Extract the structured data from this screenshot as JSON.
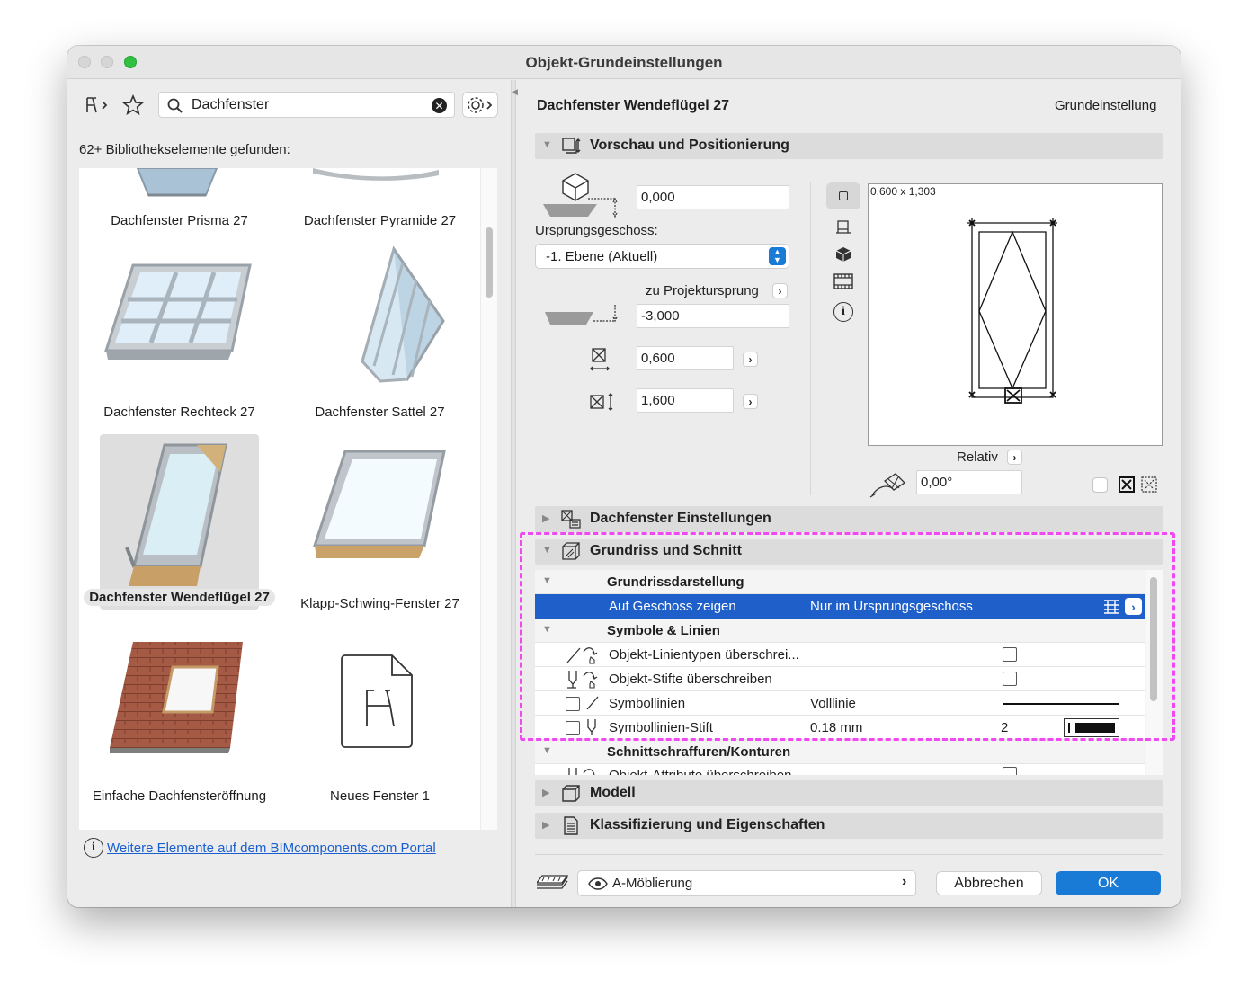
{
  "window": {
    "title": "Objekt-Grundeinstellungen"
  },
  "library": {
    "search_value": "Dachfenster",
    "results_label": "62+ Bibliothekselemente gefunden:",
    "items": [
      {
        "name": "Dachfenster Prisma 27"
      },
      {
        "name": "Dachfenster Pyramide 27"
      },
      {
        "name": "Dachfenster Rechteck 27"
      },
      {
        "name": "Dachfenster Sattel 27"
      },
      {
        "name": "Dachfenster Wendeflügel 27",
        "selected": true
      },
      {
        "name": "Klapp-Schwing-Fenster 27"
      },
      {
        "name": "Einfache Dachfensteröffnung"
      },
      {
        "name": "Neues Fenster 1"
      }
    ],
    "portal_link": "Weitere Elemente auf dem BIMcomponents.com Portal"
  },
  "object": {
    "name": "Dachfenster Wendeflügel 27",
    "mode": "Grundeinstellung"
  },
  "preview": {
    "header": "Vorschau und Positionierung",
    "elevation": "0,000",
    "home_story_label": "Ursprungsgeschoss:",
    "home_story_value": "-1. Ebene (Aktuell)",
    "project_zero_label": "zu Projektursprung",
    "project_zero_value": "-3,000",
    "width": "0,600",
    "height": "1,600",
    "size_label": "0,600 x 1,303",
    "relative_label": "Relativ",
    "angle": "0,00°"
  },
  "sections": {
    "skylight_settings": "Dachfenster Einstellungen",
    "floorplan_section": "Grundriss und Schnitt",
    "model": "Modell",
    "classification": "Klassifizierung und Eigenschaften"
  },
  "floorplan": {
    "group1": "Grundrissdarstellung",
    "show_on_stories_label": "Auf Geschoss zeigen",
    "show_on_stories_value": "Nur im Ursprungsgeschoss",
    "group2": "Symbole & Linien",
    "override_linetypes": "Objekt-Linientypen überschrei...",
    "override_pens": "Objekt-Stifte überschreiben",
    "symbol_lines_label": "Symbollinien",
    "symbol_lines_value": "Volllinie",
    "symbol_pen_label": "Symbollinien-Stift",
    "symbol_pen_value": "0.18 mm",
    "symbol_pen_number": "2",
    "group3": "Schnittschraffuren/Konturen",
    "override_attributes": "Objekt-Attribute überschreiben"
  },
  "footer": {
    "layer": "A-Möblierung",
    "cancel": "Abbrechen",
    "ok": "OK"
  },
  "colors": {
    "accent": "#1a7bd6",
    "selected_row": "#1f5fc9",
    "highlight": "#f248f2"
  }
}
